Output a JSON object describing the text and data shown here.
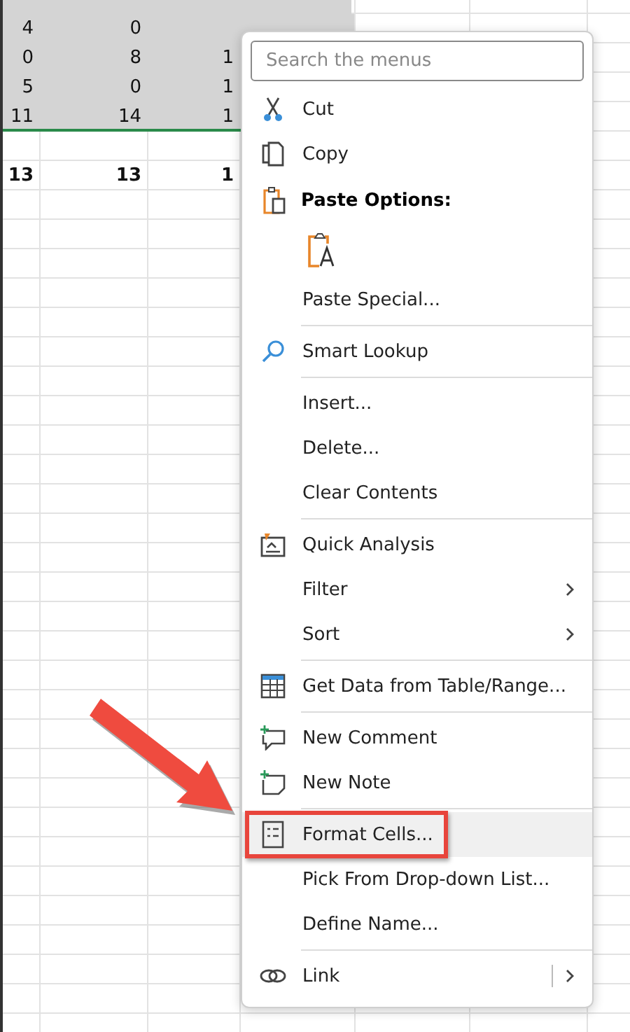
{
  "sheet": {
    "rows": [
      {
        "kind": "data",
        "selected": true,
        "cells": [
          "4",
          "0"
        ]
      },
      {
        "kind": "data",
        "selected": true,
        "cells": [
          "0",
          "8",
          "1"
        ]
      },
      {
        "kind": "data",
        "selected": true,
        "cells": [
          "5",
          "0",
          "1"
        ]
      },
      {
        "kind": "data",
        "selected": true,
        "cells": [
          "11",
          "14",
          "1"
        ]
      },
      {
        "kind": "data",
        "selected": false,
        "cells": []
      },
      {
        "kind": "total",
        "selected": false,
        "cells": [
          "13",
          "13",
          "1"
        ]
      }
    ]
  },
  "context_menu": {
    "search": {
      "placeholder": "Search the menus"
    },
    "items": [
      {
        "kind": "item",
        "label": "Cut",
        "submenu": false,
        "selected": false,
        "boxed": false
      },
      {
        "kind": "item",
        "label": "Copy",
        "submenu": false,
        "selected": false,
        "boxed": false
      },
      {
        "kind": "header",
        "label": "Paste Options:"
      },
      {
        "kind": "paste-icons"
      },
      {
        "kind": "item",
        "label": "Paste Special...",
        "submenu": false,
        "selected": false,
        "boxed": false
      },
      {
        "kind": "separator"
      },
      {
        "kind": "item",
        "label": "Smart Lookup",
        "submenu": false,
        "selected": false,
        "boxed": false
      },
      {
        "kind": "separator"
      },
      {
        "kind": "item",
        "label": "Insert...",
        "submenu": false,
        "selected": false,
        "boxed": false
      },
      {
        "kind": "item",
        "label": "Delete...",
        "submenu": false,
        "selected": false,
        "boxed": false
      },
      {
        "kind": "item",
        "label": "Clear Contents",
        "submenu": false,
        "selected": false,
        "boxed": false
      },
      {
        "kind": "separator"
      },
      {
        "kind": "item",
        "label": "Quick Analysis",
        "submenu": false,
        "selected": false,
        "boxed": false
      },
      {
        "kind": "item",
        "label": "Filter",
        "submenu": true,
        "selected": false,
        "boxed": false
      },
      {
        "kind": "item",
        "label": "Sort",
        "submenu": true,
        "selected": false,
        "boxed": false
      },
      {
        "kind": "separator"
      },
      {
        "kind": "item",
        "label": "Get Data from Table/Range...",
        "submenu": false,
        "selected": false,
        "boxed": false
      },
      {
        "kind": "separator"
      },
      {
        "kind": "item",
        "label": "New Comment",
        "submenu": false,
        "selected": false,
        "boxed": false
      },
      {
        "kind": "item",
        "label": "New Note",
        "submenu": false,
        "selected": false,
        "boxed": false
      },
      {
        "kind": "separator"
      },
      {
        "kind": "item",
        "label": "Format Cells...",
        "submenu": false,
        "selected": true,
        "boxed": true
      },
      {
        "kind": "item",
        "label": "Pick From Drop-down List...",
        "submenu": false,
        "selected": false,
        "boxed": false
      },
      {
        "kind": "item",
        "label": "Define Name...",
        "submenu": false,
        "selected": false,
        "boxed": false
      },
      {
        "kind": "separator"
      },
      {
        "kind": "item",
        "label": "Link",
        "submenu": true,
        "selected": false,
        "boxed": false
      }
    ]
  }
}
